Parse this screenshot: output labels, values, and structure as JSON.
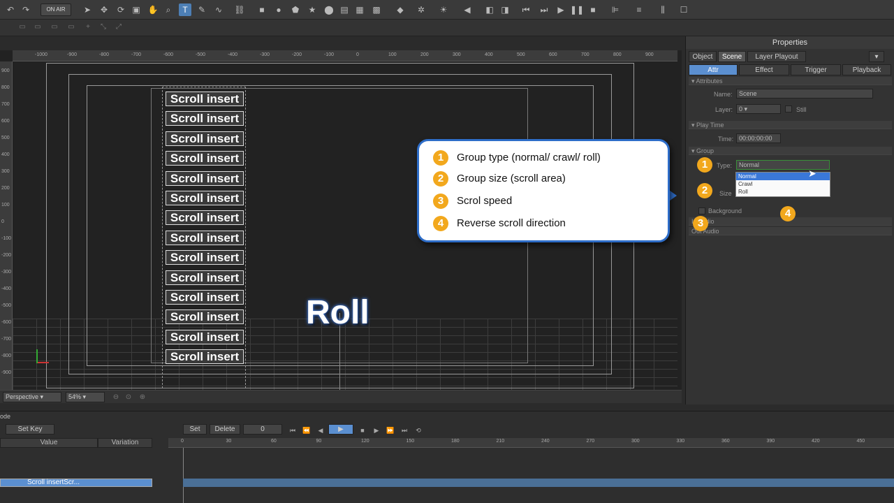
{
  "toolbar": {
    "on_air_label": "ON AIR"
  },
  "viewport": {
    "ruler_top_ticks": [
      "-1000",
      "-900",
      "-800",
      "-700",
      "-600",
      "-500",
      "-400",
      "-300",
      "-200",
      "-100",
      "0",
      "100",
      "200",
      "300",
      "400",
      "500",
      "600",
      "700",
      "800",
      "900"
    ],
    "ruler_left_ticks": [
      "900",
      "800",
      "700",
      "600",
      "500",
      "400",
      "300",
      "200",
      "100",
      "0",
      "-100",
      "-200",
      "-300",
      "-400",
      "-500",
      "-600",
      "-700",
      "-800",
      "-900"
    ],
    "scroll_items": [
      "Scroll insert",
      "Scroll insert",
      "Scroll insert",
      "Scroll insert",
      "Scroll insert",
      "Scroll insert",
      "Scroll insert",
      "Scroll insert",
      "Scroll insert",
      "Scroll insert",
      "Scroll insert",
      "Scroll insert",
      "Scroll insert",
      "Scroll insert"
    ],
    "roll_label": "Roll",
    "camera_mode": "Perspective",
    "zoom": "54%"
  },
  "properties": {
    "title": "Properties",
    "tabs": [
      "Object",
      "Scene",
      "Layer Playout"
    ],
    "subtabs": [
      "Attr",
      "Effect",
      "Trigger",
      "Playback"
    ],
    "attributes_section": "Attributes",
    "name_label": "Name:",
    "name_value": "Scene",
    "layer_label": "Layer:",
    "layer_value": "0",
    "still_label": "Still",
    "play_time_section": "Play Time",
    "time_label": "Time:",
    "time_value": "00:00:00:00",
    "group_section": "Group",
    "type_label": "Type:",
    "type_value": "Normal",
    "size_label": "Size",
    "type_options": [
      "Normal",
      "Crawl",
      "Roll"
    ],
    "background_label": "Background",
    "in_audio_label": "In Audio",
    "out_audio_label": "Out Audio"
  },
  "callout": {
    "items": [
      {
        "num": "1",
        "text": "Group type (normal/ crawl/ roll)"
      },
      {
        "num": "2",
        "text": "Group size (scroll area)"
      },
      {
        "num": "3",
        "text": "Scrol speed"
      },
      {
        "num": "4",
        "text": "Reverse scroll direction"
      }
    ]
  },
  "markers": [
    "1",
    "2",
    "3",
    "4"
  ],
  "timeline": {
    "side_label": "ode",
    "set_key_label": "Set Key",
    "set_label": "Set",
    "delete_label": "Delete",
    "frame_value": "0",
    "col_value": "Value",
    "col_variation": "Variation",
    "ruler_ticks": [
      "0",
      "30",
      "60",
      "90",
      "120",
      "150",
      "180",
      "210",
      "240",
      "270",
      "300",
      "330",
      "360",
      "390",
      "420",
      "450"
    ],
    "layer_name": "Scroll insertScr..."
  },
  "colors": {
    "accent": "#2e6dc8",
    "marker": "#f2a81d",
    "selection": "#5b8fd0"
  }
}
